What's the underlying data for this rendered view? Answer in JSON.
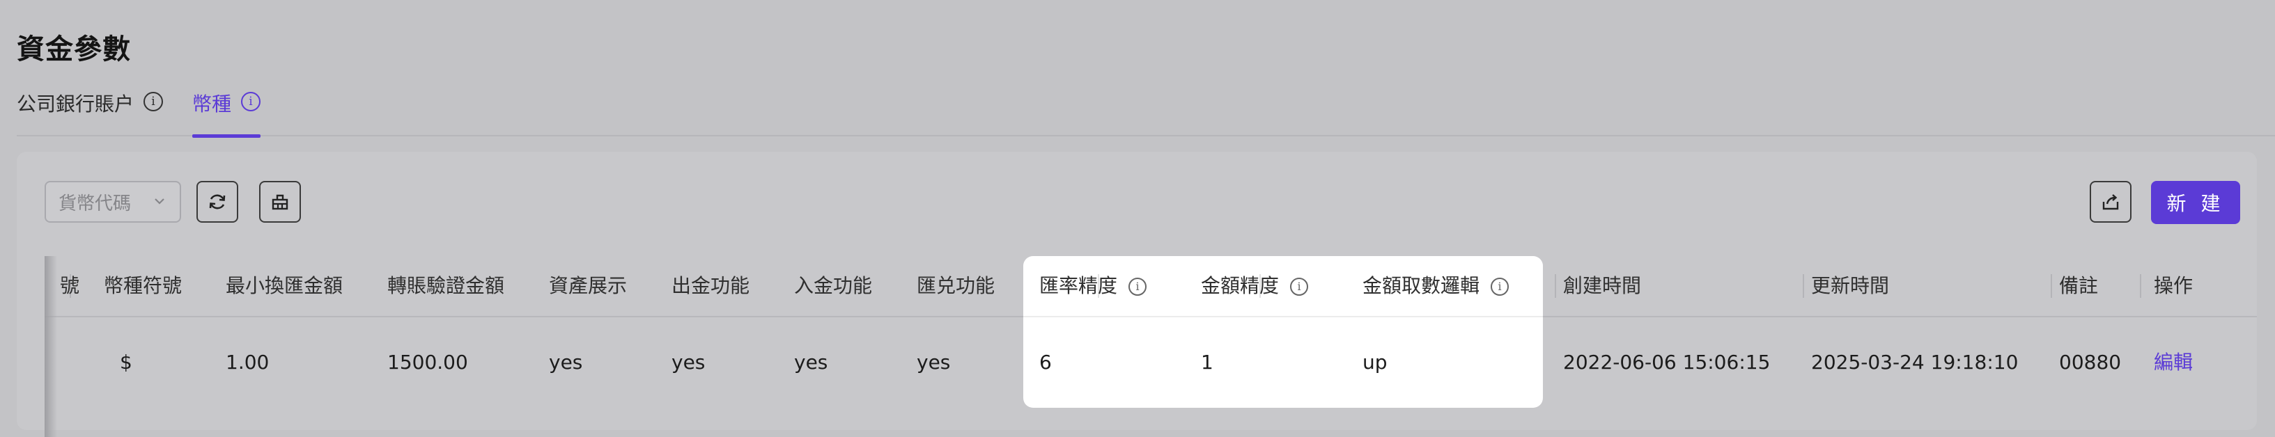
{
  "page": {
    "title": "資金參數"
  },
  "tabs": [
    {
      "label": "公司銀行賬户",
      "active": false
    },
    {
      "label": "幣種",
      "active": true
    }
  ],
  "toolbar": {
    "filter_placeholder": "貨幣代碼",
    "refresh_icon": "refresh-icon",
    "clear_icon": "eraser-icon",
    "export_icon": "export-icon",
    "new_label": "新 建"
  },
  "table": {
    "columns": {
      "id": "號",
      "symbol": "幣種符號",
      "min_exchange": "最小換匯金額",
      "transfer_verify": "轉賬驗證金額",
      "asset_display": "資產展示",
      "withdraw": "出金功能",
      "deposit": "入金功能",
      "exchange": "匯兑功能",
      "rate_precision": "匯率精度",
      "amount_precision": "金額精度",
      "amount_rounding": "金額取數邏輯",
      "created_at": "創建時間",
      "updated_at": "更新時間",
      "remark": "備註",
      "action": "操作"
    },
    "rows": [
      {
        "symbol": "$",
        "min_exchange": "1.00",
        "transfer_verify": "1500.00",
        "asset_display": "yes",
        "withdraw": "yes",
        "deposit": "yes",
        "exchange": "yes",
        "rate_precision": "6",
        "amount_precision": "1",
        "amount_rounding": "up",
        "created_at": "2022-06-06 15:06:15",
        "updated_at": "2025-03-24 19:18:10",
        "remark": "00880",
        "action": "編輯"
      }
    ]
  },
  "colors": {
    "accent": "#5b3bd6",
    "overlay": "#c3c3c6"
  }
}
